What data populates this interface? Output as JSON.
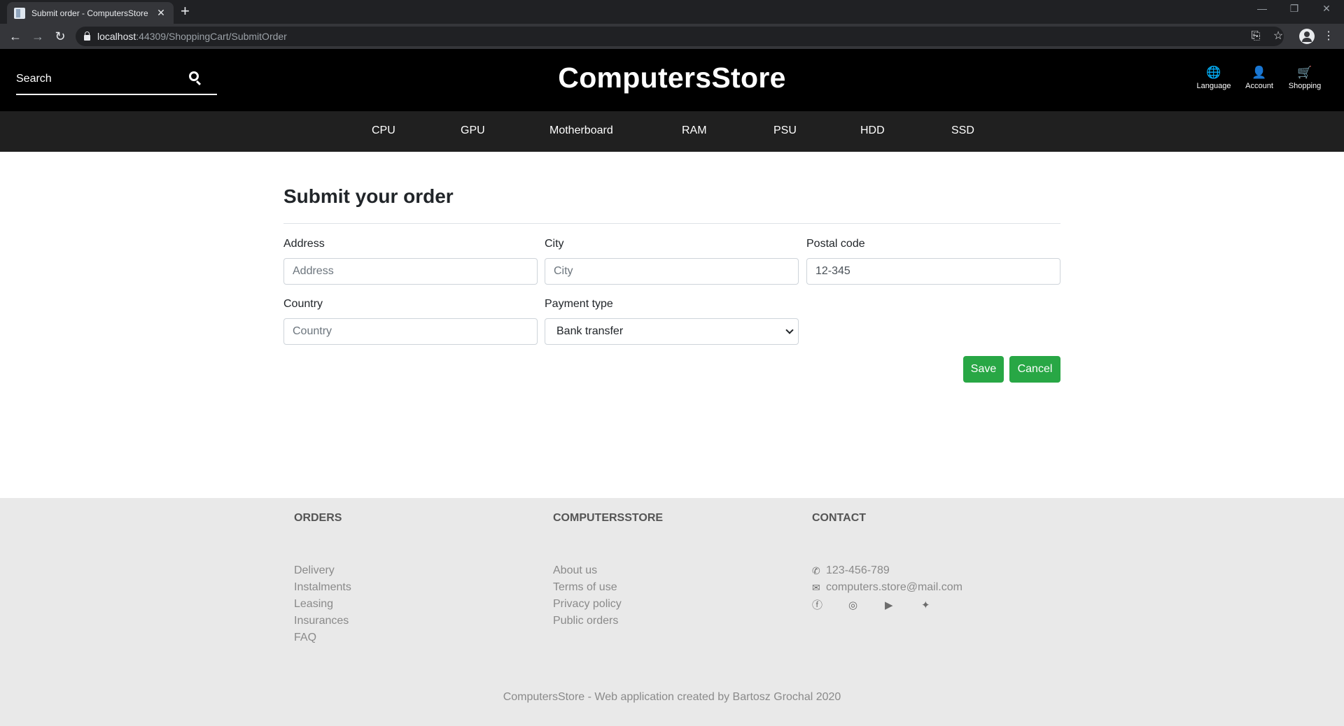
{
  "browser": {
    "tab_title": "Submit order - ComputersStore",
    "tab_close": "✕",
    "new_tab": "+",
    "url_host": "localhost",
    "url_path": ":44309/ShoppingCart/SubmitOrder",
    "window_minimize": "—",
    "window_restore": "❐",
    "window_close": "✕",
    "back": "←",
    "forward": "→",
    "reload": "↻",
    "translate": "⎘",
    "star": "☆",
    "menu": "⋮"
  },
  "header": {
    "search_placeholder": "Search",
    "logo": "ComputersStore",
    "actions": [
      {
        "label": "Language",
        "icon": "globe-icon",
        "glyph": "🌐"
      },
      {
        "label": "Account",
        "icon": "user-icon",
        "glyph": "👤"
      },
      {
        "label": "Shopping",
        "icon": "cart-icon",
        "glyph": "🛒"
      }
    ]
  },
  "categories": [
    "CPU",
    "GPU",
    "Motherboard",
    "RAM",
    "PSU",
    "HDD",
    "SSD"
  ],
  "form": {
    "title": "Submit your order",
    "address": {
      "label": "Address",
      "placeholder": "Address"
    },
    "city": {
      "label": "City",
      "placeholder": "City"
    },
    "postal_code": {
      "label": "Postal code",
      "value": "12-345"
    },
    "country": {
      "label": "Country",
      "placeholder": "Country"
    },
    "payment_type": {
      "label": "Payment type",
      "value": "Bank transfer"
    },
    "save_label": "Save",
    "cancel_label": "Cancel",
    "button_color": "#28a745"
  },
  "footer": {
    "orders": {
      "heading": "ORDERS",
      "links": [
        "Delivery",
        "Instalments",
        "Leasing",
        "Insurances",
        "FAQ"
      ]
    },
    "store": {
      "heading": "COMPUTERSSTORE",
      "links": [
        "About us",
        "Terms of use",
        "Privacy policy",
        "Public orders"
      ]
    },
    "contact": {
      "heading": "CONTACT",
      "phone": "123-456-789",
      "email": "computers.store@mail.com",
      "phone_glyph": "✆",
      "email_glyph": "✉",
      "social": [
        {
          "icon": "facebook-icon",
          "glyph": "ⓕ"
        },
        {
          "icon": "instagram-icon",
          "glyph": "◎"
        },
        {
          "icon": "youtube-icon",
          "glyph": "▶"
        },
        {
          "icon": "twitter-icon",
          "glyph": "✦"
        }
      ]
    },
    "copyright": "ComputersStore - Web application created by Bartosz Grochal 2020"
  }
}
